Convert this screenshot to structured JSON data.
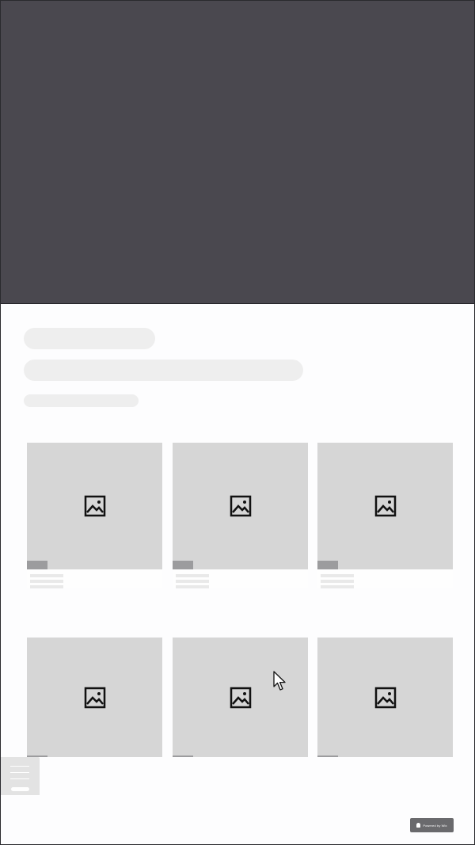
{
  "hero": {
    "color": "#4a484f"
  },
  "skeleton": {
    "color": "#eeeeee"
  },
  "grid": {
    "cards": [
      {
        "icon": "image-placeholder-icon"
      },
      {
        "icon": "image-placeholder-icon"
      },
      {
        "icon": "image-placeholder-icon"
      },
      {
        "icon": "image-placeholder-icon"
      },
      {
        "icon": "image-placeholder-icon"
      },
      {
        "icon": "image-placeholder-icon"
      }
    ]
  },
  "menu_button": {
    "icon": "hamburger-icon"
  },
  "badge": {
    "text": "Powered by Wix",
    "icon": "shield-icon"
  },
  "cursor": {
    "icon": "mouse-pointer-icon"
  }
}
